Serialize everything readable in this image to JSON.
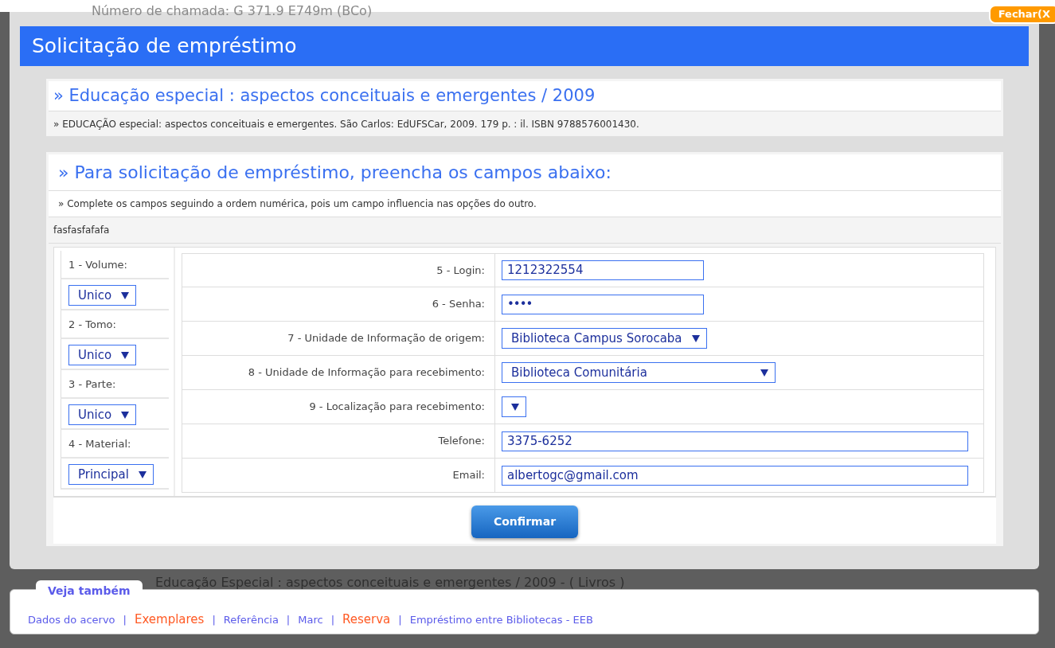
{
  "background": {
    "call_number": "Número de chamada: G 371.9 E749m (BCo)",
    "record_title": "Educação Especial : aspectos conceituais e emergentes / 2009 - ( Livros )"
  },
  "close_button": "Fechar(X",
  "dialog": {
    "title": "Solicitação de empréstimo",
    "book": {
      "title": "» Educação especial : aspectos conceituais e emergentes / 2009",
      "reference": "» EDUCAÇÃO especial: aspectos conceituais e emergentes. São Carlos: EdUFSCar, 2009. 179 p. : il. ISBN 9788576001430."
    },
    "form": {
      "heading": "» Para solicitação de empréstimo, preencha os campos abaixo:",
      "instruction": "» Complete os campos seguindo a ordem numérica, pois um campo influencia nas opções do outro.",
      "note": "fasfasfafafa",
      "left_fields": [
        {
          "label": "1 - Volume:",
          "kind": "select",
          "value": "Unico"
        },
        {
          "label": "2 - Tomo:",
          "kind": "select",
          "value": "Unico"
        },
        {
          "label": "3 - Parte:",
          "kind": "select",
          "value": "Unico"
        },
        {
          "label": "4 - Material:",
          "kind": "select",
          "value": "Principal"
        }
      ],
      "right_fields": [
        {
          "label": "5 - Login:",
          "kind": "text",
          "value": "1212322554"
        },
        {
          "label": "6 - Senha:",
          "kind": "password",
          "value": "••••"
        },
        {
          "label": "7 - Unidade de Informação de origem:",
          "kind": "select",
          "value": "Biblioteca Campus Sorocaba"
        },
        {
          "label": "8 - Unidade de Informação para recebimento:",
          "kind": "select",
          "value": "Biblioteca Comunitária"
        },
        {
          "label": "9 - Localização para recebimento:",
          "kind": "select"
        },
        {
          "label": "Telefone:",
          "kind": "text",
          "value": "3375-6252"
        },
        {
          "label": "Email:",
          "kind": "text",
          "value": "albertogc@gmail.com"
        }
      ],
      "submit": "Confirmar"
    }
  },
  "see_also": {
    "title": "Veja também",
    "separator": "|",
    "links": [
      {
        "label": "Dados do acervo",
        "highlighted": false
      },
      {
        "label": "Exemplares",
        "highlighted": true
      },
      {
        "label": "Referência",
        "highlighted": false
      },
      {
        "label": "Marc",
        "highlighted": false
      },
      {
        "label": "Reserva",
        "highlighted": true
      },
      {
        "label": "Empréstimo entre Bibliotecas - EEB",
        "highlighted": false
      }
    ]
  }
}
